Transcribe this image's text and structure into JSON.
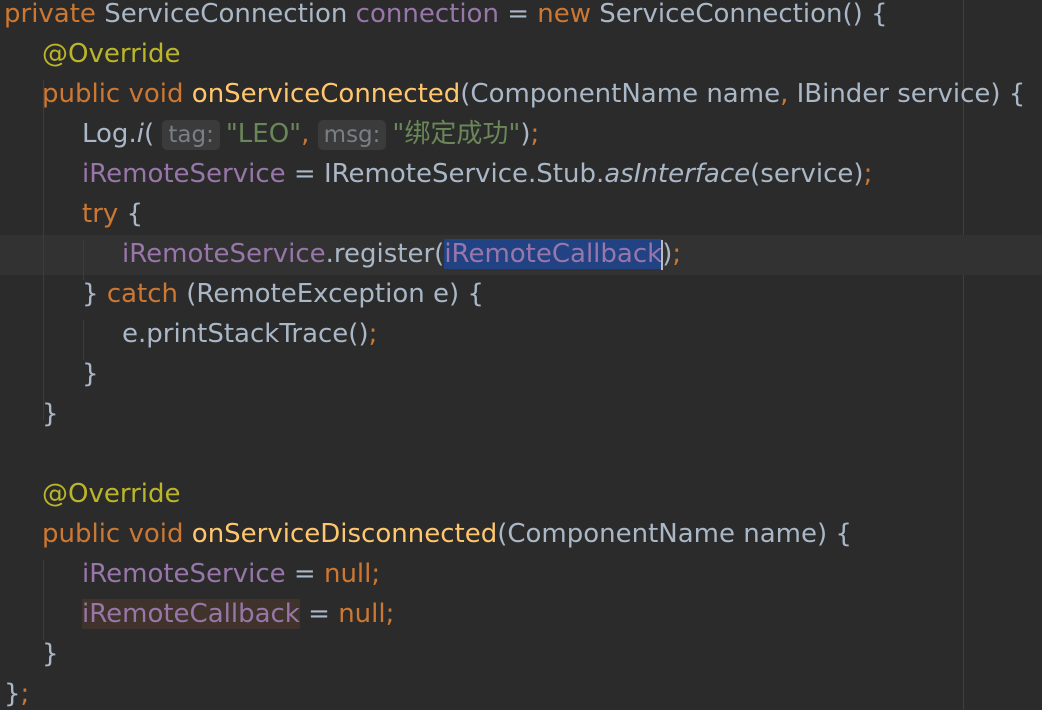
{
  "code": {
    "l1": {
      "kw_private": "private",
      "type": " ServiceConnection ",
      "field": "connection",
      "eq": " = ",
      "kw_new": "new",
      "ctor": " ServiceConnection() {"
    },
    "l2": {
      "ann": "@Override"
    },
    "l3": {
      "kw": "public void ",
      "method": "onServiceConnected",
      "params": "(ComponentName name",
      "comma": ",",
      "params2": " IBinder service) {"
    },
    "l4": {
      "cls": "Log.",
      "m": "i",
      "paren": "(",
      "hint_tag": "tag:",
      "str1": "\"LEO\"",
      "comma": ",",
      "hint_msg": "msg:",
      "str2": "\"绑定成功\"",
      "end": ")",
      "semi": ";"
    },
    "l5": {
      "field": "iRemoteService",
      "eq": " = IRemoteService.Stub.",
      "m": "asInterface",
      "args": "(service)",
      "semi": ";"
    },
    "l6": {
      "kw": "try",
      "brace": " {"
    },
    "l7": {
      "field": "iRemoteService",
      "call": ".register(",
      "arg": "iRemoteCallback",
      "close": ")",
      "semi": ";"
    },
    "l8": {
      "brace": "} ",
      "kw": "catch",
      "rest": " (RemoteException e) {"
    },
    "l9": {
      "stmt": "e.printStackTrace()",
      "semi": ";"
    },
    "l10": {
      "brace": "}"
    },
    "l11": {
      "brace": "}"
    },
    "l13": {
      "ann": "@Override"
    },
    "l14": {
      "kw": "public void ",
      "method": "onServiceDisconnected",
      "params": "(ComponentName name) {"
    },
    "l15": {
      "field": "iRemoteService",
      "eq": " = ",
      "kw": "null",
      "semi": ";"
    },
    "l16": {
      "field": "iRemoteCallback",
      "eq": " = ",
      "kw": "null",
      "semi": ";"
    },
    "l17": {
      "brace": "}"
    },
    "l18": {
      "brace": "}",
      "semi": ";"
    }
  },
  "colors": {
    "background": "#2b2b2b",
    "keyword": "#cc7832",
    "annotation": "#bbb529",
    "field": "#9876aa",
    "method": "#ffc66d",
    "string": "#6a8759",
    "plain": "#a9b7c6",
    "selection": "#214283"
  }
}
